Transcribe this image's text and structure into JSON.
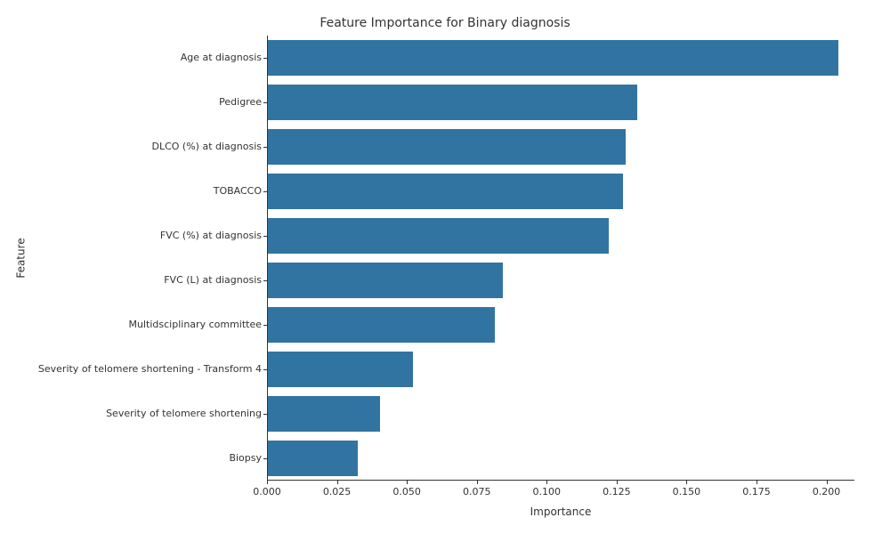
{
  "chart_data": {
    "type": "bar",
    "orientation": "horizontal",
    "title": "Feature Importance for Binary diagnosis",
    "xlabel": "Importance",
    "ylabel": "Feature",
    "xlim": [
      0.0,
      0.21
    ],
    "xticks": [
      0.0,
      0.025,
      0.05,
      0.075,
      0.1,
      0.125,
      0.15,
      0.175,
      0.2
    ],
    "xtick_labels": [
      "0.000",
      "0.025",
      "0.050",
      "0.075",
      "0.100",
      "0.125",
      "0.150",
      "0.175",
      "0.200"
    ],
    "categories": [
      "Age at diagnosis",
      "Pedigree",
      "DLCO (%) at diagnosis",
      "TOBACCO",
      "FVC (%) at diagnosis",
      "FVC (L) at diagnosis",
      "Multidsciplinary committee",
      "Severity of telomere shortening - Transform 4",
      "Severity of telomere shortening",
      "Biopsy"
    ],
    "values": [
      0.204,
      0.132,
      0.128,
      0.127,
      0.122,
      0.084,
      0.081,
      0.052,
      0.04,
      0.032
    ],
    "bar_color": "#3274A1"
  }
}
